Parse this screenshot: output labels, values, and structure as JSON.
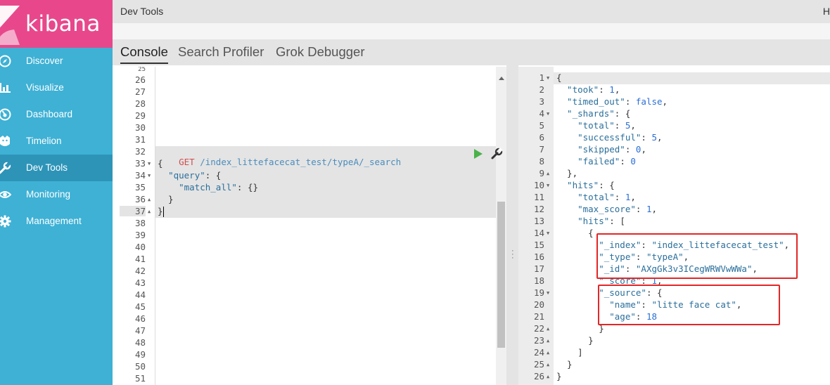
{
  "app": {
    "logo_text": "kibana"
  },
  "sidebar": {
    "items": [
      {
        "label": "Discover",
        "icon": "compass-icon"
      },
      {
        "label": "Visualize",
        "icon": "bar-chart-icon"
      },
      {
        "label": "Dashboard",
        "icon": "dashboard-icon"
      },
      {
        "label": "Timelion",
        "icon": "timelion-icon"
      },
      {
        "label": "Dev Tools",
        "icon": "wrench-icon",
        "active": true
      },
      {
        "label": "Monitoring",
        "icon": "eye-icon"
      },
      {
        "label": "Management",
        "icon": "gear-icon"
      }
    ]
  },
  "header": {
    "title": "Dev Tools",
    "right_hint": "H"
  },
  "tabs": [
    {
      "label": "Console",
      "active": true
    },
    {
      "label": "Search Profiler"
    },
    {
      "label": "Grok Debugger"
    }
  ],
  "editor": {
    "partial_line": "25",
    "line_numbers": [
      "26",
      "27",
      "28",
      "29",
      "30",
      "31",
      "32",
      "33",
      "34",
      "35",
      "36",
      "37",
      "38",
      "39",
      "40",
      "41",
      "42",
      "43",
      "44",
      "45",
      "46",
      "47",
      "48",
      "49",
      "50",
      "51"
    ],
    "request": {
      "method": "GET",
      "path": " /index_littefacecat_test/typeA/_search",
      "line1": "{",
      "line2_key": "\"query\"",
      "line2_rest": ": {",
      "line3_key": "\"match_all\"",
      "line3_rest": ": {}",
      "line4": "  }",
      "line5": "}"
    }
  },
  "output": {
    "line_numbers": [
      "1",
      "2",
      "3",
      "4",
      "5",
      "6",
      "7",
      "8",
      "9",
      "10",
      "11",
      "12",
      "13",
      "14",
      "15",
      "16",
      "17",
      "18",
      "19",
      "20",
      "21",
      "22",
      "23",
      "24",
      "25",
      "26"
    ],
    "lines": [
      {
        "segs": [
          [
            "p",
            "{"
          ]
        ]
      },
      {
        "segs": [
          [
            "k",
            "  \"took\""
          ],
          [
            "p",
            ": "
          ],
          [
            "n",
            "1"
          ],
          [
            "p",
            ","
          ]
        ]
      },
      {
        "segs": [
          [
            "k",
            "  \"timed_out\""
          ],
          [
            "p",
            ": "
          ],
          [
            "kw",
            "false"
          ],
          [
            "p",
            ","
          ]
        ]
      },
      {
        "segs": [
          [
            "k",
            "  \"_shards\""
          ],
          [
            "p",
            ": {"
          ]
        ]
      },
      {
        "segs": [
          [
            "k",
            "    \"total\""
          ],
          [
            "p",
            ": "
          ],
          [
            "n",
            "5"
          ],
          [
            "p",
            ","
          ]
        ]
      },
      {
        "segs": [
          [
            "k",
            "    \"successful\""
          ],
          [
            "p",
            ": "
          ],
          [
            "n",
            "5"
          ],
          [
            "p",
            ","
          ]
        ]
      },
      {
        "segs": [
          [
            "k",
            "    \"skipped\""
          ],
          [
            "p",
            ": "
          ],
          [
            "n",
            "0"
          ],
          [
            "p",
            ","
          ]
        ]
      },
      {
        "segs": [
          [
            "k",
            "    \"failed\""
          ],
          [
            "p",
            ": "
          ],
          [
            "n",
            "0"
          ]
        ]
      },
      {
        "segs": [
          [
            "p",
            "  },"
          ]
        ]
      },
      {
        "segs": [
          [
            "k",
            "  \"hits\""
          ],
          [
            "p",
            ": {"
          ]
        ]
      },
      {
        "segs": [
          [
            "k",
            "    \"total\""
          ],
          [
            "p",
            ": "
          ],
          [
            "n",
            "1"
          ],
          [
            "p",
            ","
          ]
        ]
      },
      {
        "segs": [
          [
            "k",
            "    \"max_score\""
          ],
          [
            "p",
            ": "
          ],
          [
            "n",
            "1"
          ],
          [
            "p",
            ","
          ]
        ]
      },
      {
        "segs": [
          [
            "k",
            "    \"hits\""
          ],
          [
            "p",
            ": ["
          ]
        ]
      },
      {
        "segs": [
          [
            "p",
            "      {"
          ]
        ]
      },
      {
        "segs": [
          [
            "k",
            "        \"_index\""
          ],
          [
            "p",
            ": "
          ],
          [
            "s",
            "\"index_littefacecat_test\""
          ],
          [
            "p",
            ","
          ]
        ]
      },
      {
        "segs": [
          [
            "k",
            "        \"_type\""
          ],
          [
            "p",
            ": "
          ],
          [
            "s",
            "\"typeA\""
          ],
          [
            "p",
            ","
          ]
        ]
      },
      {
        "segs": [
          [
            "k",
            "        \"_id\""
          ],
          [
            "p",
            ": "
          ],
          [
            "s",
            "\"AXgGk3v3ICegWRWVwWWa\""
          ],
          [
            "p",
            ","
          ]
        ]
      },
      {
        "segs": [
          [
            "k",
            "        \"_score\""
          ],
          [
            "p",
            ": "
          ],
          [
            "n",
            "1"
          ],
          [
            "p",
            ","
          ]
        ]
      },
      {
        "segs": [
          [
            "k",
            "        \"_source\""
          ],
          [
            "p",
            ": {"
          ]
        ]
      },
      {
        "segs": [
          [
            "k",
            "          \"name\""
          ],
          [
            "p",
            ": "
          ],
          [
            "s",
            "\"litte face cat\""
          ],
          [
            "p",
            ","
          ]
        ]
      },
      {
        "segs": [
          [
            "k",
            "          \"age\""
          ],
          [
            "p",
            ": "
          ],
          [
            "n",
            "18"
          ]
        ]
      },
      {
        "segs": [
          [
            "p",
            "        }"
          ]
        ]
      },
      {
        "segs": [
          [
            "p",
            "      }"
          ]
        ]
      },
      {
        "segs": [
          [
            "p",
            "    ]"
          ]
        ]
      },
      {
        "segs": [
          [
            "p",
            "  }"
          ]
        ]
      },
      {
        "segs": [
          [
            "p",
            "}"
          ]
        ]
      }
    ],
    "fold_lines": {
      "0": "down",
      "3": "down",
      "8": "up",
      "9": "down",
      "13": "down",
      "18": "down",
      "21": "up",
      "22": "up",
      "23": "up",
      "24": "up",
      "25": "up"
    }
  },
  "colors": {
    "sidebar": "#3eb1d5",
    "logo_bg": "#e8488b",
    "highlight_box": "#e32626",
    "play": "#49b24a"
  }
}
